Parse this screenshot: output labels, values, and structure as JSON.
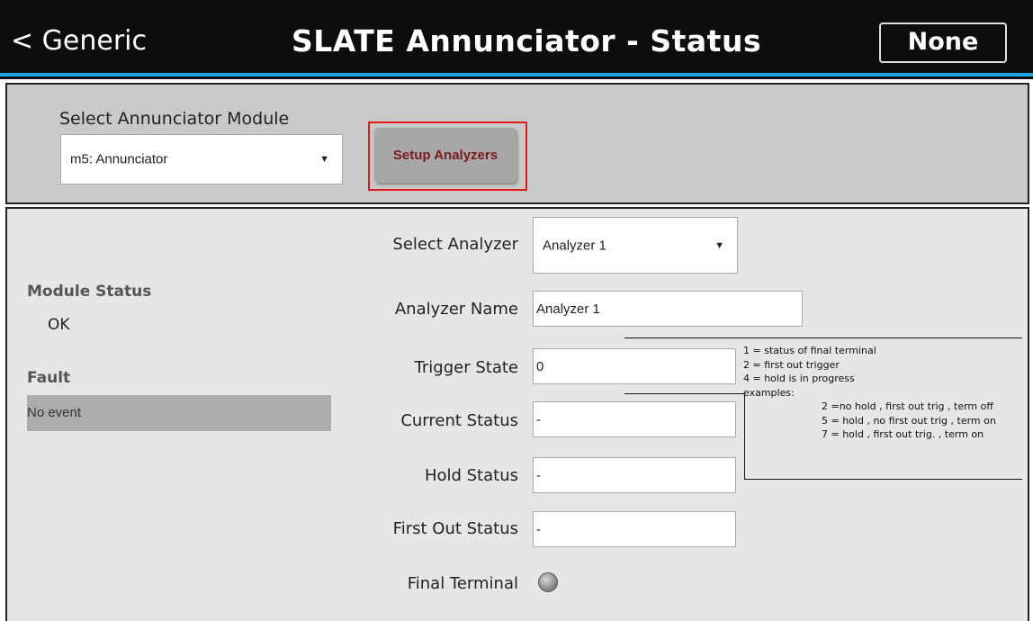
{
  "header": {
    "back_label": "< Generic",
    "title": "SLATE Annunciator - Status",
    "right_button": "None",
    "colors": {
      "background": "#0d0d0d",
      "accent_line": "#1aa3dc"
    }
  },
  "module_select": {
    "label": "Select Annunciator Module",
    "value": "m5: Annunciator"
  },
  "setup_button": {
    "label": "Setup Analyzers"
  },
  "status": {
    "module_status_label": "Module Status",
    "module_status_value": "OK",
    "fault_label": "Fault",
    "fault_value": "No event"
  },
  "analyzer": {
    "select_label": "Select Analyzer",
    "select_value": "Analyzer 1",
    "name_label": "Analyzer Name",
    "name_value": "Analyzer 1",
    "trigger_state_label": "Trigger State",
    "trigger_state_value": "0",
    "current_status_label": "Current Status",
    "current_status_value": "-",
    "hold_status_label": "Hold Status",
    "hold_status_value": "-",
    "first_out_status_label": "First Out Status",
    "first_out_status_value": "-",
    "final_terminal_label": "Final Terminal",
    "final_terminal_icon": "led-indicator-icon"
  },
  "legend": {
    "lines": [
      "1 = status of final terminal",
      "2 = first out trigger",
      "4 = hold is in progress",
      "examples:"
    ],
    "examples": [
      "2 =no hold , first out trig , term off",
      "5 = hold , no first out trig , term on",
      "7 = hold , first out trig. , term on"
    ]
  }
}
